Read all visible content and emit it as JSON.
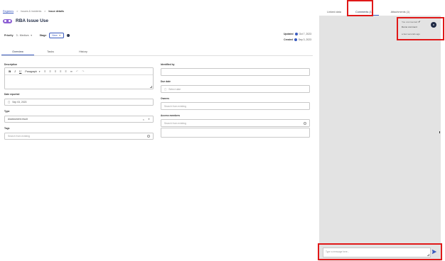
{
  "breadcrumb": {
    "items": [
      "Registers",
      "Issues & incidents",
      "Issue details"
    ],
    "separator": ">"
  },
  "header": {
    "title": "RBA Issue Use",
    "priority_label": "Priority",
    "priority_value": "3 - Medium",
    "stage_label": "Stage",
    "stage_value": "New",
    "updated_label": "Updated",
    "updated_value": "Oct 7, 2023",
    "created_label": "Created",
    "created_value": "Sep 3, 2023"
  },
  "tabs": [
    "Overview",
    "Tasks",
    "History"
  ],
  "form": {
    "description_label": "Description",
    "paragraph_label": "Paragraph",
    "date_reported_label": "Date reported",
    "date_reported_value": "Sep 03, 2023",
    "type_label": "Type",
    "type_value": "Assessment result",
    "tags_label": "Tags",
    "tags_placeholder": "Search from existing",
    "identified_by_label": "Identified by",
    "due_date_label": "Due date",
    "due_date_placeholder": "Select date",
    "owners_label": "Owners",
    "owners_placeholder": "Search from existing",
    "access_members_label": "Access members",
    "access_members_placeholder": "Search from existing"
  },
  "right_tabs": [
    "Linked data",
    "Comments (1)",
    "Attachments (1)"
  ],
  "comment": {
    "meta": "You commented",
    "text": "Demo comment",
    "time": "a few seconds ago",
    "avatar": "M"
  },
  "chat": {
    "placeholder": "Type a message here..."
  },
  "colors": {
    "accent": "#3a5bbf",
    "highlight": "#e01818",
    "panel_bg": "#e3e3e3"
  }
}
